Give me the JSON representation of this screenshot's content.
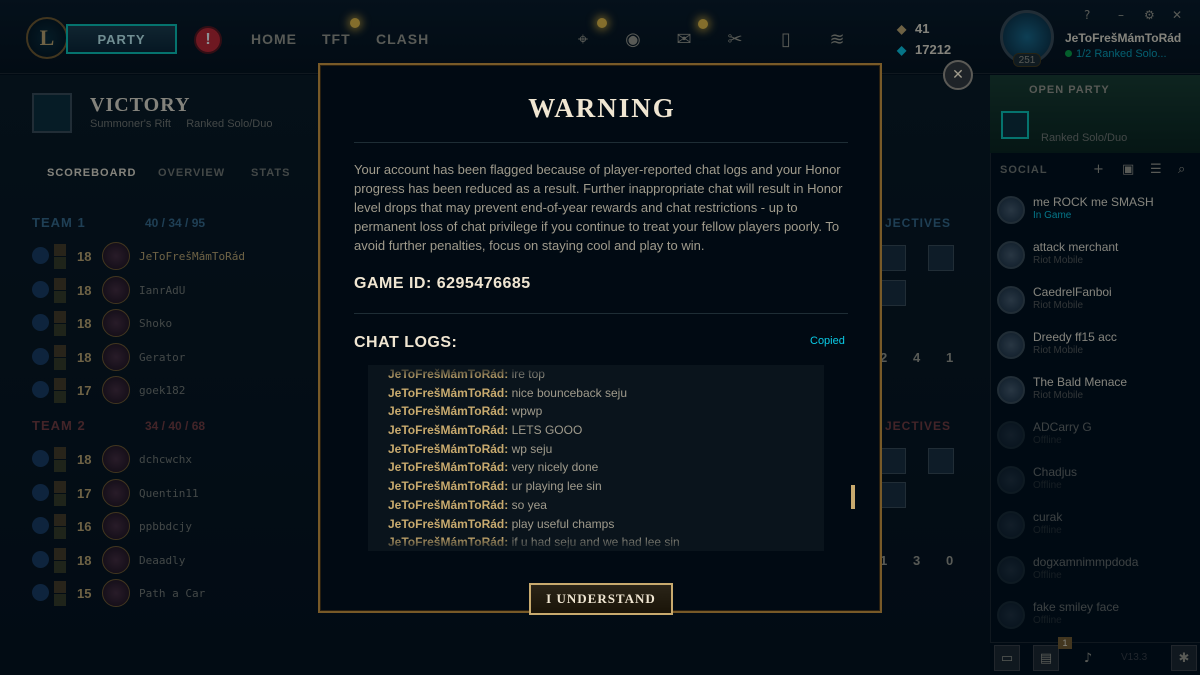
{
  "topbar": {
    "logo_letter": "L",
    "party_label": "PARTY",
    "alert_label": "!",
    "nav": [
      "HOME",
      "TFT",
      "CLASH"
    ],
    "icons": [
      "crosshair-icon",
      "profile-icon",
      "collection-icon",
      "loot-icon",
      "clipboard-icon",
      "store-icon"
    ],
    "rp_icon": "rp-icon",
    "be_icon": "blue-essence-icon",
    "rp": "41",
    "blue_essence": "17212",
    "summoner_name": "JeToFrešMámToRád",
    "summoner_level": "251",
    "summoner_status": "1/2 Ranked Solo...",
    "window_controls": [
      "?",
      "–",
      "⚙",
      "✕"
    ]
  },
  "match": {
    "result": "VICTORY",
    "map": "Summoner's Rift",
    "queue": "Ranked Solo/Duo",
    "tabs": [
      "SCOREBOARD",
      "OVERVIEW",
      "STATS"
    ],
    "team1": {
      "label": "TEAM 1",
      "kda": "40 / 34 / 95",
      "objectives_label": "JECTIVES",
      "objective_counts": [
        "2",
        "4",
        "1"
      ],
      "players": [
        {
          "level": "18",
          "name": "JeToFrešMámToRád",
          "me": true
        },
        {
          "level": "18",
          "name": "IanrAdU"
        },
        {
          "level": "18",
          "name": "Shoko"
        },
        {
          "level": "18",
          "name": "Gerator"
        },
        {
          "level": "17",
          "name": "goek182"
        }
      ]
    },
    "team2": {
      "label": "TEAM 2",
      "kda": "34 / 40 / 68",
      "objectives_label": "JECTIVES",
      "objective_counts": [
        "1",
        "3",
        "0"
      ],
      "players": [
        {
          "level": "18",
          "name": "dchcwchx"
        },
        {
          "level": "17",
          "name": "Quentin11"
        },
        {
          "level": "16",
          "name": "ppbbdcjy"
        },
        {
          "level": "18",
          "name": "Deaadly"
        },
        {
          "level": "15",
          "name": "Path a Car"
        }
      ]
    }
  },
  "modal": {
    "title": "WARNING",
    "close_label": "✕",
    "body": "Your account has been flagged because of player-reported chat logs and your Honor progress has been reduced as a result. Further inappropriate chat will result in Honor level drops that may prevent end-of-year rewards and chat restrictions - up to permanent loss of chat privilege if you continue to treat your fellow players poorly. To avoid further penalties, focus on staying cool and play to win.",
    "game_id_label": "GAME ID: 6295476685",
    "chat_logs_label": "CHAT LOGS:",
    "copied_label": "Copied",
    "chat_logs": [
      {
        "speaker": "JeToFrešMámToRád:",
        "message": "ire top"
      },
      {
        "speaker": "JeToFrešMámToRád:",
        "message": "nice bounceback seju"
      },
      {
        "speaker": "JeToFrešMámToRád:",
        "message": "wpwp"
      },
      {
        "speaker": "JeToFrešMámToRád:",
        "message": "LETS GOOO"
      },
      {
        "speaker": "JeToFrešMámToRád:",
        "message": "wp seju"
      },
      {
        "speaker": "JeToFrešMámToRád:",
        "message": "very nicely done"
      },
      {
        "speaker": "JeToFrešMámToRád:",
        "message": "ur playing lee sin"
      },
      {
        "speaker": "JeToFrešMámToRád:",
        "message": "so yea"
      },
      {
        "speaker": "JeToFrešMámToRád:",
        "message": "play useful champs"
      },
      {
        "speaker": "JeToFrešMámToRád:",
        "message": "if u had seju and we had lee sin"
      }
    ],
    "confirm_label": "I UNDERSTAND"
  },
  "sidebar": {
    "open_party_label": "OPEN PARTY",
    "open_party_mode": "Ranked Solo/Duo",
    "social_label": "SOCIAL",
    "social_icons": [
      "add-friend-icon",
      "add-folder-icon",
      "list-icon",
      "search-icon"
    ],
    "friends": [
      {
        "name": "me ROCK me SMASH",
        "status": "In Game",
        "in_game": true
      },
      {
        "name": "attack merchant",
        "status": "Riot Mobile"
      },
      {
        "name": "CaedrelFanboi",
        "status": "Riot Mobile"
      },
      {
        "name": "Dreedy ff15 acc",
        "status": "Riot Mobile"
      },
      {
        "name": "The Bald Menace",
        "status": "Riot Mobile"
      },
      {
        "name": "ADCarry G",
        "status": "Offline",
        "offline": true
      },
      {
        "name": "Chadjus",
        "status": "Offline",
        "offline": true
      },
      {
        "name": "curak",
        "status": "Offline",
        "offline": true
      },
      {
        "name": "dogxamnimmpdoda",
        "status": "Offline",
        "offline": true
      },
      {
        "name": "fake smiley face",
        "status": "Offline",
        "offline": true
      }
    ],
    "bottom_icons": [
      "chat-icon",
      "missions-icon",
      "mic-icon",
      "bug-report-icon"
    ],
    "missions_badge": "1",
    "version": "V13.3"
  },
  "colors": {
    "gold": "#c8aa6e",
    "teal": "#0ac8b9",
    "blue_text": "#0acbe6",
    "bg": "#010a13"
  }
}
